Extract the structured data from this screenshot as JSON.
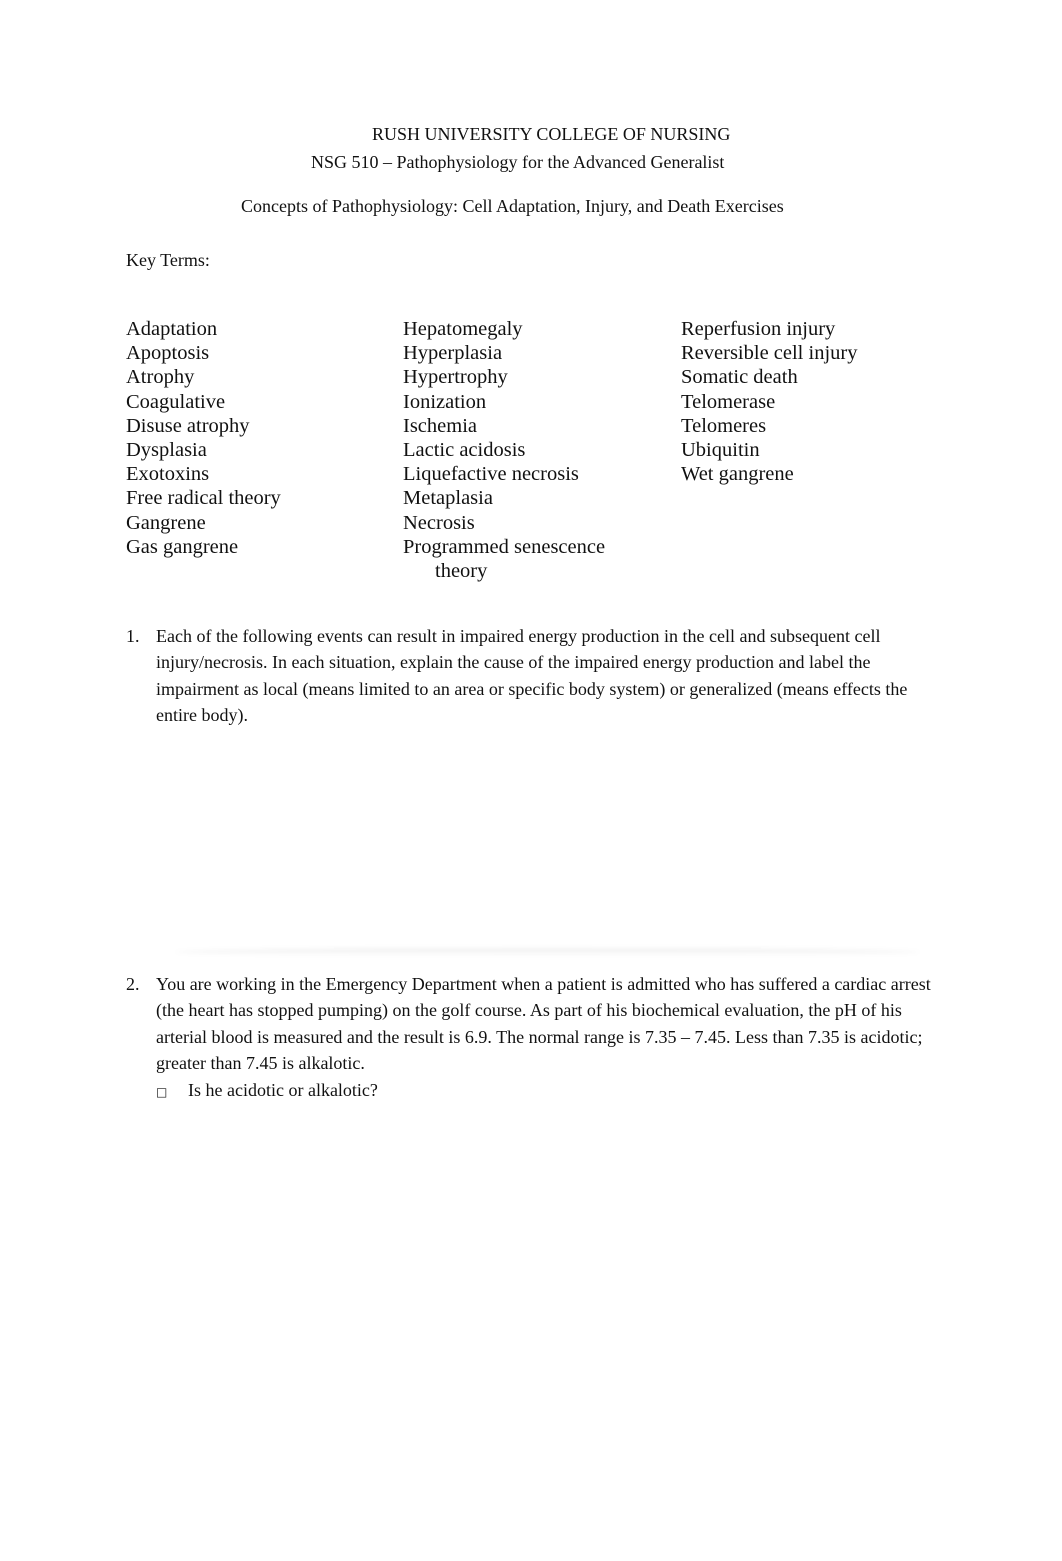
{
  "header": {
    "institution": "RUSH UNIVERSITY COLLEGE OF NURSING",
    "course": "NSG 510 – Pathophysiology for the Advanced Generalist",
    "title": "Concepts of Pathophysiology: Cell Adaptation, Injury, and Death Exercises"
  },
  "key_terms": {
    "label": "Key Terms:",
    "columns": [
      [
        "Adaptation",
        "Apoptosis",
        "Atrophy",
        "Coagulative",
        "Disuse atrophy",
        "Dysplasia",
        "Exotoxins",
        "Free radical theory",
        "Gangrene",
        "Gas gangrene"
      ],
      [
        "Hepatomegaly",
        "Hyperplasia",
        "Hypertrophy",
        "Ionization",
        "Ischemia",
        "Lactic acidosis",
        "Liquefactive necrosis",
        "Metaplasia",
        "Necrosis",
        "Programmed senescence",
        "theory"
      ],
      [
        "Reperfusion injury",
        "Reversible cell injury",
        "Somatic death",
        "Telomerase",
        "Telomeres",
        "Ubiquitin",
        "Wet gangrene"
      ]
    ]
  },
  "questions": [
    {
      "number": "1.",
      "text": "Each of the following events can result in impaired energy production in the cell and subsequent cell injury/necrosis. In each situation, explain the cause of the impaired energy production and label the impairment as  local (means limited to an area or specific body system) or  generalized  (means effects the entire body)."
    },
    {
      "number": "2.",
      "text": "You are working in the Emergency Department when a patient is admitted who has suffered a cardiac arrest (the heart has stopped pumping) on the golf course. As part of his biochemical evaluation, the pH of his arterial blood is measured and the result is 6.9.    The normal range is 7.35 – 7.45.  Less than 7.35 is acidotic; greater than 7.45 is alkalotic.",
      "sub_bullet": "□",
      "sub_question": "Is he acidotic or alkalotic?"
    }
  ]
}
